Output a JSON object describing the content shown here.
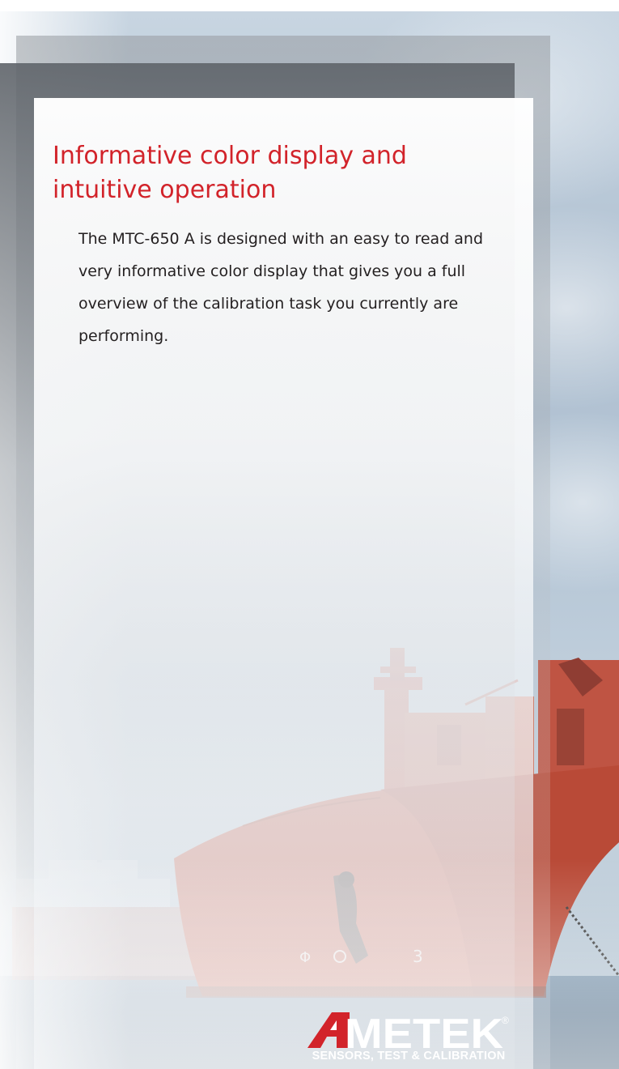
{
  "heading": "Informative color display and intuitive operation",
  "body": "The MTC-650 A is designed with an easy to read and very informative color display that gives you a full overview of the calibration task you currently are performing.",
  "logo": {
    "wordmark": "AMETEK",
    "registered": "®",
    "tagline": "SENSORS, TEST & CALIBRATION"
  },
  "colors": {
    "heading_red": "#d2232a",
    "body_text": "#231f20",
    "hull_red": "#c8553f"
  }
}
